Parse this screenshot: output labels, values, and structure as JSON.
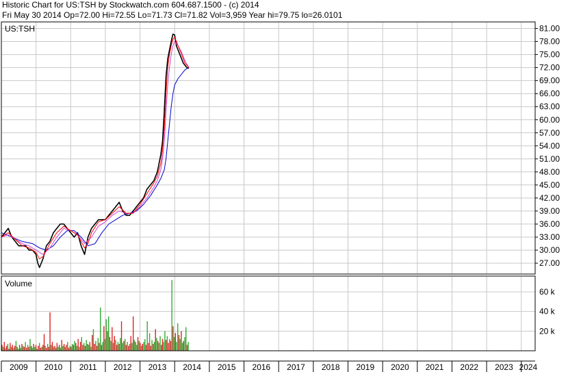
{
  "header": {
    "line1": "Historic Chart for US:TSH by Stockwatch.com 604.687.1500 - (c) 2014",
    "line2": "Fri May 30 2014   Op=72.00  Hi=72.55  Lo=71.73  Cl=71.82  Vol=3,959   Year hi=79.75  lo=26.0101"
  },
  "colors": {
    "grid": "#c8c8c8",
    "price": "#000000",
    "ma_short": "#ff0000",
    "ma_medium": "#cc44cc",
    "ma_long": "#0000cc",
    "volume_up": "#33aa33",
    "volume_down": "#dd2222"
  },
  "chart_data": [
    {
      "type": "line",
      "title": "US:TSH",
      "x_tick_labels": [
        "2009",
        "2010",
        "2011",
        "2012",
        "2013",
        "2014",
        "2015",
        "2016",
        "2017",
        "2018",
        "2019",
        "2020",
        "2021",
        "2022",
        "2023",
        "2024"
      ],
      "y_tick_labels": [
        "81.00",
        "78.00",
        "75.00",
        "72.00",
        "69.00",
        "66.00",
        "63.00",
        "60.00",
        "57.00",
        "54.00",
        "51.00",
        "48.00",
        "45.00",
        "42.00",
        "39.00",
        "36.00",
        "33.00",
        "30.00",
        "27.00"
      ],
      "ylim": [
        24.5,
        82.5
      ],
      "xlim": [
        2009.0,
        2024.4
      ],
      "grid": true,
      "series": [
        {
          "role": "price",
          "x": [
            2009.0,
            2009.1,
            2009.2,
            2009.3,
            2009.4,
            2009.5,
            2009.6,
            2009.7,
            2009.8,
            2009.9,
            2010.0,
            2010.05,
            2010.1,
            2010.2,
            2010.3,
            2010.4,
            2010.5,
            2010.6,
            2010.7,
            2010.8,
            2010.9,
            2011.0,
            2011.1,
            2011.2,
            2011.3,
            2011.4,
            2011.5,
            2011.6,
            2011.7,
            2011.8,
            2011.9,
            2012.0,
            2012.1,
            2012.2,
            2012.3,
            2012.4,
            2012.5,
            2012.6,
            2012.7,
            2012.8,
            2012.9,
            2013.0,
            2013.1,
            2013.2,
            2013.3,
            2013.4,
            2013.5,
            2013.55,
            2013.6,
            2013.65,
            2013.7,
            2013.75,
            2013.8,
            2013.85,
            2013.9,
            2013.95,
            2014.0,
            2014.05,
            2014.1,
            2014.15,
            2014.2,
            2014.25,
            2014.3,
            2014.35,
            2014.41
          ],
          "values": [
            33,
            34,
            35,
            33,
            32,
            31,
            31,
            31,
            30,
            30,
            29,
            27,
            26,
            28,
            31,
            32,
            34,
            35,
            36,
            36,
            35,
            34,
            33,
            34,
            31,
            29,
            33,
            35,
            36,
            37,
            37,
            37,
            38,
            39,
            40,
            41,
            39,
            38,
            38,
            39,
            40,
            41,
            42,
            44,
            45,
            46,
            48,
            50,
            52,
            55,
            62,
            70,
            74,
            76,
            78,
            79.7,
            79.5,
            77,
            76,
            75,
            74,
            73,
            72.5,
            72,
            71.82
          ]
        },
        {
          "role": "ma_short",
          "x": [
            2009.0,
            2009.2,
            2009.4,
            2009.6,
            2009.8,
            2010.0,
            2010.1,
            2010.2,
            2010.4,
            2010.6,
            2010.8,
            2011.0,
            2011.2,
            2011.4,
            2011.5,
            2011.6,
            2011.8,
            2012.0,
            2012.2,
            2012.4,
            2012.6,
            2012.8,
            2013.0,
            2013.2,
            2013.4,
            2013.5,
            2013.6,
            2013.65,
            2013.7,
            2013.75,
            2013.8,
            2013.85,
            2013.9,
            2013.95,
            2014.0,
            2014.1,
            2014.2,
            2014.3,
            2014.41
          ],
          "values": [
            33,
            34,
            32.5,
            31,
            30.5,
            29.5,
            28,
            28.5,
            31.5,
            34,
            35.5,
            34.5,
            33.5,
            30.5,
            31.5,
            34,
            36.5,
            37,
            38.5,
            40,
            38.5,
            38.5,
            40.5,
            43,
            45.5,
            47,
            50,
            53,
            58,
            66,
            72,
            75,
            77,
            78.5,
            79,
            77,
            75,
            73,
            72
          ]
        },
        {
          "role": "ma_medium",
          "x": [
            2009.0,
            2009.2,
            2009.4,
            2009.6,
            2009.8,
            2010.0,
            2010.2,
            2010.4,
            2010.6,
            2010.8,
            2011.0,
            2011.2,
            2011.4,
            2011.6,
            2011.8,
            2012.0,
            2012.2,
            2012.4,
            2012.6,
            2012.8,
            2013.0,
            2013.2,
            2013.4,
            2013.5,
            2013.6,
            2013.65,
            2013.7,
            2013.75,
            2013.8,
            2013.85,
            2013.9,
            2013.95,
            2014.0,
            2014.1,
            2014.2,
            2014.3,
            2014.41
          ],
          "values": [
            33,
            33.5,
            32.5,
            31.5,
            31,
            30,
            29,
            30.5,
            33,
            35,
            34.5,
            33.5,
            31.5,
            33,
            35.5,
            36.5,
            38,
            39,
            38.5,
            38.5,
            40,
            42,
            44.5,
            46,
            48.5,
            51,
            55,
            62,
            68,
            72,
            75,
            77,
            78,
            77,
            75.5,
            73.5,
            72
          ]
        },
        {
          "role": "ma_long",
          "x": [
            2009.0,
            2009.3,
            2009.6,
            2009.9,
            2010.1,
            2010.3,
            2010.5,
            2010.7,
            2010.9,
            2011.1,
            2011.3,
            2011.5,
            2011.7,
            2011.9,
            2012.1,
            2012.3,
            2012.5,
            2012.7,
            2012.9,
            2013.1,
            2013.3,
            2013.5,
            2013.6,
            2013.7,
            2013.75,
            2013.8,
            2013.85,
            2013.9,
            2013.95,
            2014.0,
            2014.1,
            2014.2,
            2014.3,
            2014.41
          ],
          "values": [
            34,
            33,
            32,
            31.5,
            30.5,
            30,
            31,
            33,
            34.5,
            34.5,
            33,
            31,
            31.5,
            34,
            36,
            37,
            38,
            38.5,
            39,
            40.5,
            42.5,
            45,
            46.5,
            48.5,
            51,
            55,
            59,
            63,
            66,
            68,
            69.5,
            70.5,
            71.5,
            72
          ]
        }
      ]
    },
    {
      "type": "bar",
      "title": "Volume",
      "y_tick_labels": [
        "60 k",
        "40 k",
        "20 k"
      ],
      "ylim": [
        0,
        76000
      ],
      "bar_x_range": [
        2009.0,
        2014.41
      ],
      "bars": [
        [
          6000,
          "d"
        ],
        [
          4000,
          "u"
        ],
        [
          9000,
          "d"
        ],
        [
          3000,
          "u"
        ],
        [
          5000,
          "d"
        ],
        [
          7000,
          "u"
        ],
        [
          2000,
          "d"
        ],
        [
          8000,
          "d"
        ],
        [
          4000,
          "u"
        ],
        [
          6000,
          "d"
        ],
        [
          3000,
          "u"
        ],
        [
          5000,
          "d"
        ],
        [
          10000,
          "u"
        ],
        [
          4000,
          "d"
        ],
        [
          2000,
          "u"
        ],
        [
          6000,
          "d"
        ],
        [
          3000,
          "u"
        ],
        [
          7000,
          "d"
        ],
        [
          5000,
          "u"
        ],
        [
          4000,
          "d"
        ],
        [
          9000,
          "u"
        ],
        [
          3000,
          "d"
        ],
        [
          6000,
          "u"
        ],
        [
          4000,
          "d"
        ],
        [
          12000,
          "u"
        ],
        [
          5000,
          "d"
        ],
        [
          3000,
          "u"
        ],
        [
          7000,
          "d"
        ],
        [
          4000,
          "u"
        ],
        [
          6000,
          "d"
        ],
        [
          2000,
          "u"
        ],
        [
          5000,
          "d"
        ],
        [
          8000,
          "u"
        ],
        [
          3000,
          "d"
        ],
        [
          4000,
          "u"
        ],
        [
          6000,
          "d"
        ],
        [
          17000,
          "d"
        ],
        [
          5000,
          "u"
        ],
        [
          3000,
          "d"
        ],
        [
          7000,
          "u"
        ],
        [
          4000,
          "d"
        ],
        [
          39000,
          "d"
        ],
        [
          6000,
          "u"
        ],
        [
          9000,
          "d"
        ],
        [
          4000,
          "u"
        ],
        [
          5000,
          "d"
        ],
        [
          3000,
          "u"
        ],
        [
          8000,
          "d"
        ],
        [
          4000,
          "u"
        ],
        [
          6000,
          "d"
        ],
        [
          3000,
          "u"
        ],
        [
          11000,
          "d"
        ],
        [
          5000,
          "u"
        ],
        [
          7000,
          "d"
        ],
        [
          4000,
          "u"
        ],
        [
          6000,
          "d"
        ],
        [
          9000,
          "u"
        ],
        [
          3000,
          "d"
        ],
        [
          5000,
          "u"
        ],
        [
          4000,
          "d"
        ],
        [
          7000,
          "u"
        ],
        [
          6000,
          "d"
        ],
        [
          10000,
          "u"
        ],
        [
          8000,
          "d"
        ],
        [
          5000,
          "u"
        ],
        [
          12000,
          "d"
        ],
        [
          4000,
          "u"
        ],
        [
          9000,
          "d"
        ],
        [
          14000,
          "u"
        ],
        [
          6000,
          "d"
        ],
        [
          8000,
          "u"
        ],
        [
          5000,
          "d"
        ],
        [
          11000,
          "u"
        ],
        [
          7000,
          "d"
        ],
        [
          6000,
          "u"
        ],
        [
          9000,
          "d"
        ],
        [
          4000,
          "u"
        ],
        [
          16000,
          "d"
        ],
        [
          22000,
          "u"
        ],
        [
          7000,
          "d"
        ],
        [
          10000,
          "u"
        ],
        [
          5000,
          "d"
        ],
        [
          13000,
          "u"
        ],
        [
          8000,
          "d"
        ],
        [
          44000,
          "u"
        ],
        [
          6000,
          "d"
        ],
        [
          9000,
          "u"
        ],
        [
          25000,
          "d"
        ],
        [
          12000,
          "u"
        ],
        [
          32000,
          "u"
        ],
        [
          20000,
          "d"
        ],
        [
          35000,
          "u"
        ],
        [
          14000,
          "d"
        ],
        [
          10000,
          "u"
        ],
        [
          24000,
          "d"
        ],
        [
          8000,
          "u"
        ],
        [
          15000,
          "d"
        ],
        [
          11000,
          "u"
        ],
        [
          6000,
          "d"
        ],
        [
          9000,
          "u"
        ],
        [
          7000,
          "d"
        ],
        [
          13000,
          "u"
        ],
        [
          30000,
          "d"
        ],
        [
          8000,
          "u"
        ],
        [
          10000,
          "d"
        ],
        [
          12000,
          "u"
        ],
        [
          6000,
          "d"
        ],
        [
          9000,
          "u"
        ],
        [
          5000,
          "d"
        ],
        [
          7000,
          "u"
        ],
        [
          15000,
          "d"
        ],
        [
          8000,
          "u"
        ],
        [
          35000,
          "d"
        ],
        [
          11000,
          "u"
        ],
        [
          9000,
          "d"
        ],
        [
          6000,
          "u"
        ],
        [
          14000,
          "d"
        ],
        [
          10000,
          "u"
        ],
        [
          8000,
          "d"
        ],
        [
          5000,
          "u"
        ],
        [
          7000,
          "d"
        ],
        [
          9000,
          "u"
        ],
        [
          12000,
          "u"
        ],
        [
          6000,
          "d"
        ],
        [
          30000,
          "u"
        ],
        [
          8000,
          "d"
        ],
        [
          18000,
          "u"
        ],
        [
          5000,
          "d"
        ],
        [
          11000,
          "u"
        ],
        [
          7000,
          "d"
        ],
        [
          9000,
          "u"
        ],
        [
          22000,
          "d"
        ],
        [
          13000,
          "u"
        ],
        [
          10000,
          "d"
        ],
        [
          8000,
          "u"
        ],
        [
          15000,
          "u"
        ],
        [
          6000,
          "d"
        ],
        [
          12000,
          "d"
        ],
        [
          9000,
          "u"
        ],
        [
          20000,
          "u"
        ],
        [
          11000,
          "d"
        ],
        [
          15000,
          "u"
        ],
        [
          8000,
          "d"
        ],
        [
          12000,
          "u"
        ],
        [
          10000,
          "d"
        ],
        [
          72000,
          "u"
        ],
        [
          25000,
          "d"
        ],
        [
          14000,
          "u"
        ],
        [
          18000,
          "d"
        ],
        [
          9000,
          "u"
        ],
        [
          28000,
          "u"
        ],
        [
          16000,
          "d"
        ],
        [
          12000,
          "u"
        ],
        [
          20000,
          "d"
        ],
        [
          8000,
          "u"
        ],
        [
          10000,
          "d"
        ],
        [
          14000,
          "u"
        ],
        [
          24000,
          "u"
        ],
        [
          6000,
          "d"
        ],
        [
          9000,
          "u"
        ]
      ]
    }
  ]
}
